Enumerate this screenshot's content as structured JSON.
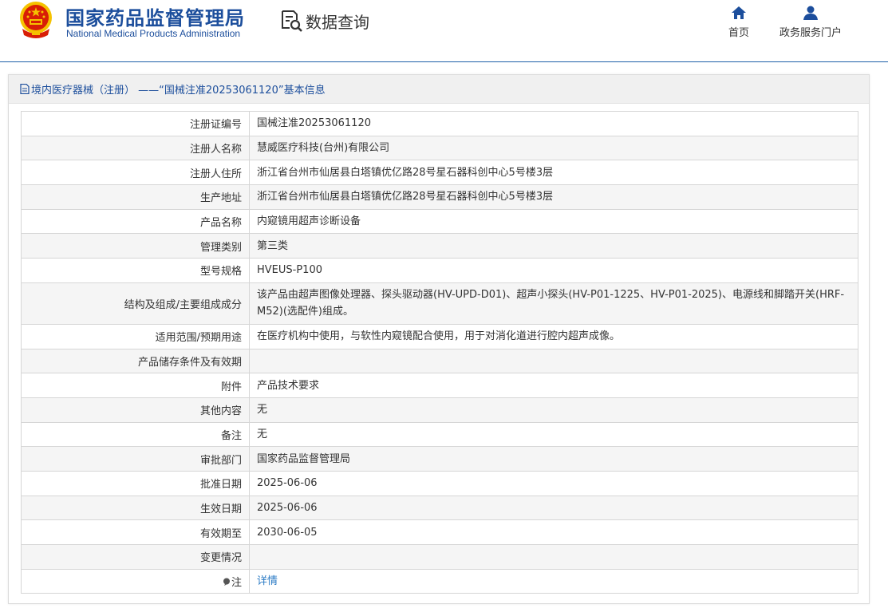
{
  "header": {
    "title_cn": "国家药品监督管理局",
    "title_en": "National Medical Products Administration",
    "query_label": "数据查询",
    "nav": {
      "home_label": "首页",
      "portal_label": "政务服务门户"
    }
  },
  "colors": {
    "brand_blue": "#1c4e9c",
    "link_blue": "#2b7bc5",
    "emblem_red": "#d81e06",
    "emblem_gold": "#f5c200"
  },
  "panel": {
    "title": "境内医疗器械（注册） ——“国械注准20253061120”基本信息"
  },
  "rows": [
    {
      "key": "注册证编号",
      "value": "国械注准20253061120"
    },
    {
      "key": "注册人名称",
      "value": "慧威医疗科技(台州)有限公司"
    },
    {
      "key": "注册人住所",
      "value": "浙江省台州市仙居县白塔镇优亿路28号星石器科创中心5号楼3层"
    },
    {
      "key": "生产地址",
      "value": "浙江省台州市仙居县白塔镇优亿路28号星石器科创中心5号楼3层"
    },
    {
      "key": "产品名称",
      "value": "内窥镜用超声诊断设备"
    },
    {
      "key": "管理类别",
      "value": "第三类"
    },
    {
      "key": "型号规格",
      "value": "HVEUS-P100"
    },
    {
      "key": "结构及组成/主要组成成分",
      "value": "该产品由超声图像处理器、探头驱动器(HV-UPD-D01)、超声小探头(HV-P01-1225、HV-P01-2025)、电源线和脚踏开关(HRF-M52)(选配件)组成。"
    },
    {
      "key": "适用范围/预期用途",
      "value": "在医疗机构中使用，与软性内窥镜配合使用，用于对消化道进行腔内超声成像。"
    },
    {
      "key": "产品储存条件及有效期",
      "value": ""
    },
    {
      "key": "附件",
      "value": "产品技术要求"
    },
    {
      "key": "其他内容",
      "value": "无"
    },
    {
      "key": "备注",
      "value": "无"
    },
    {
      "key": "审批部门",
      "value": "国家药品监督管理局"
    },
    {
      "key": "批准日期",
      "value": "2025-06-06"
    },
    {
      "key": "生效日期",
      "value": "2025-06-06"
    },
    {
      "key": "有效期至",
      "value": "2030-06-05"
    },
    {
      "key": "变更情况",
      "value": ""
    },
    {
      "key": "注",
      "value": "详情",
      "key_icon": "note-pin-icon"
    }
  ]
}
